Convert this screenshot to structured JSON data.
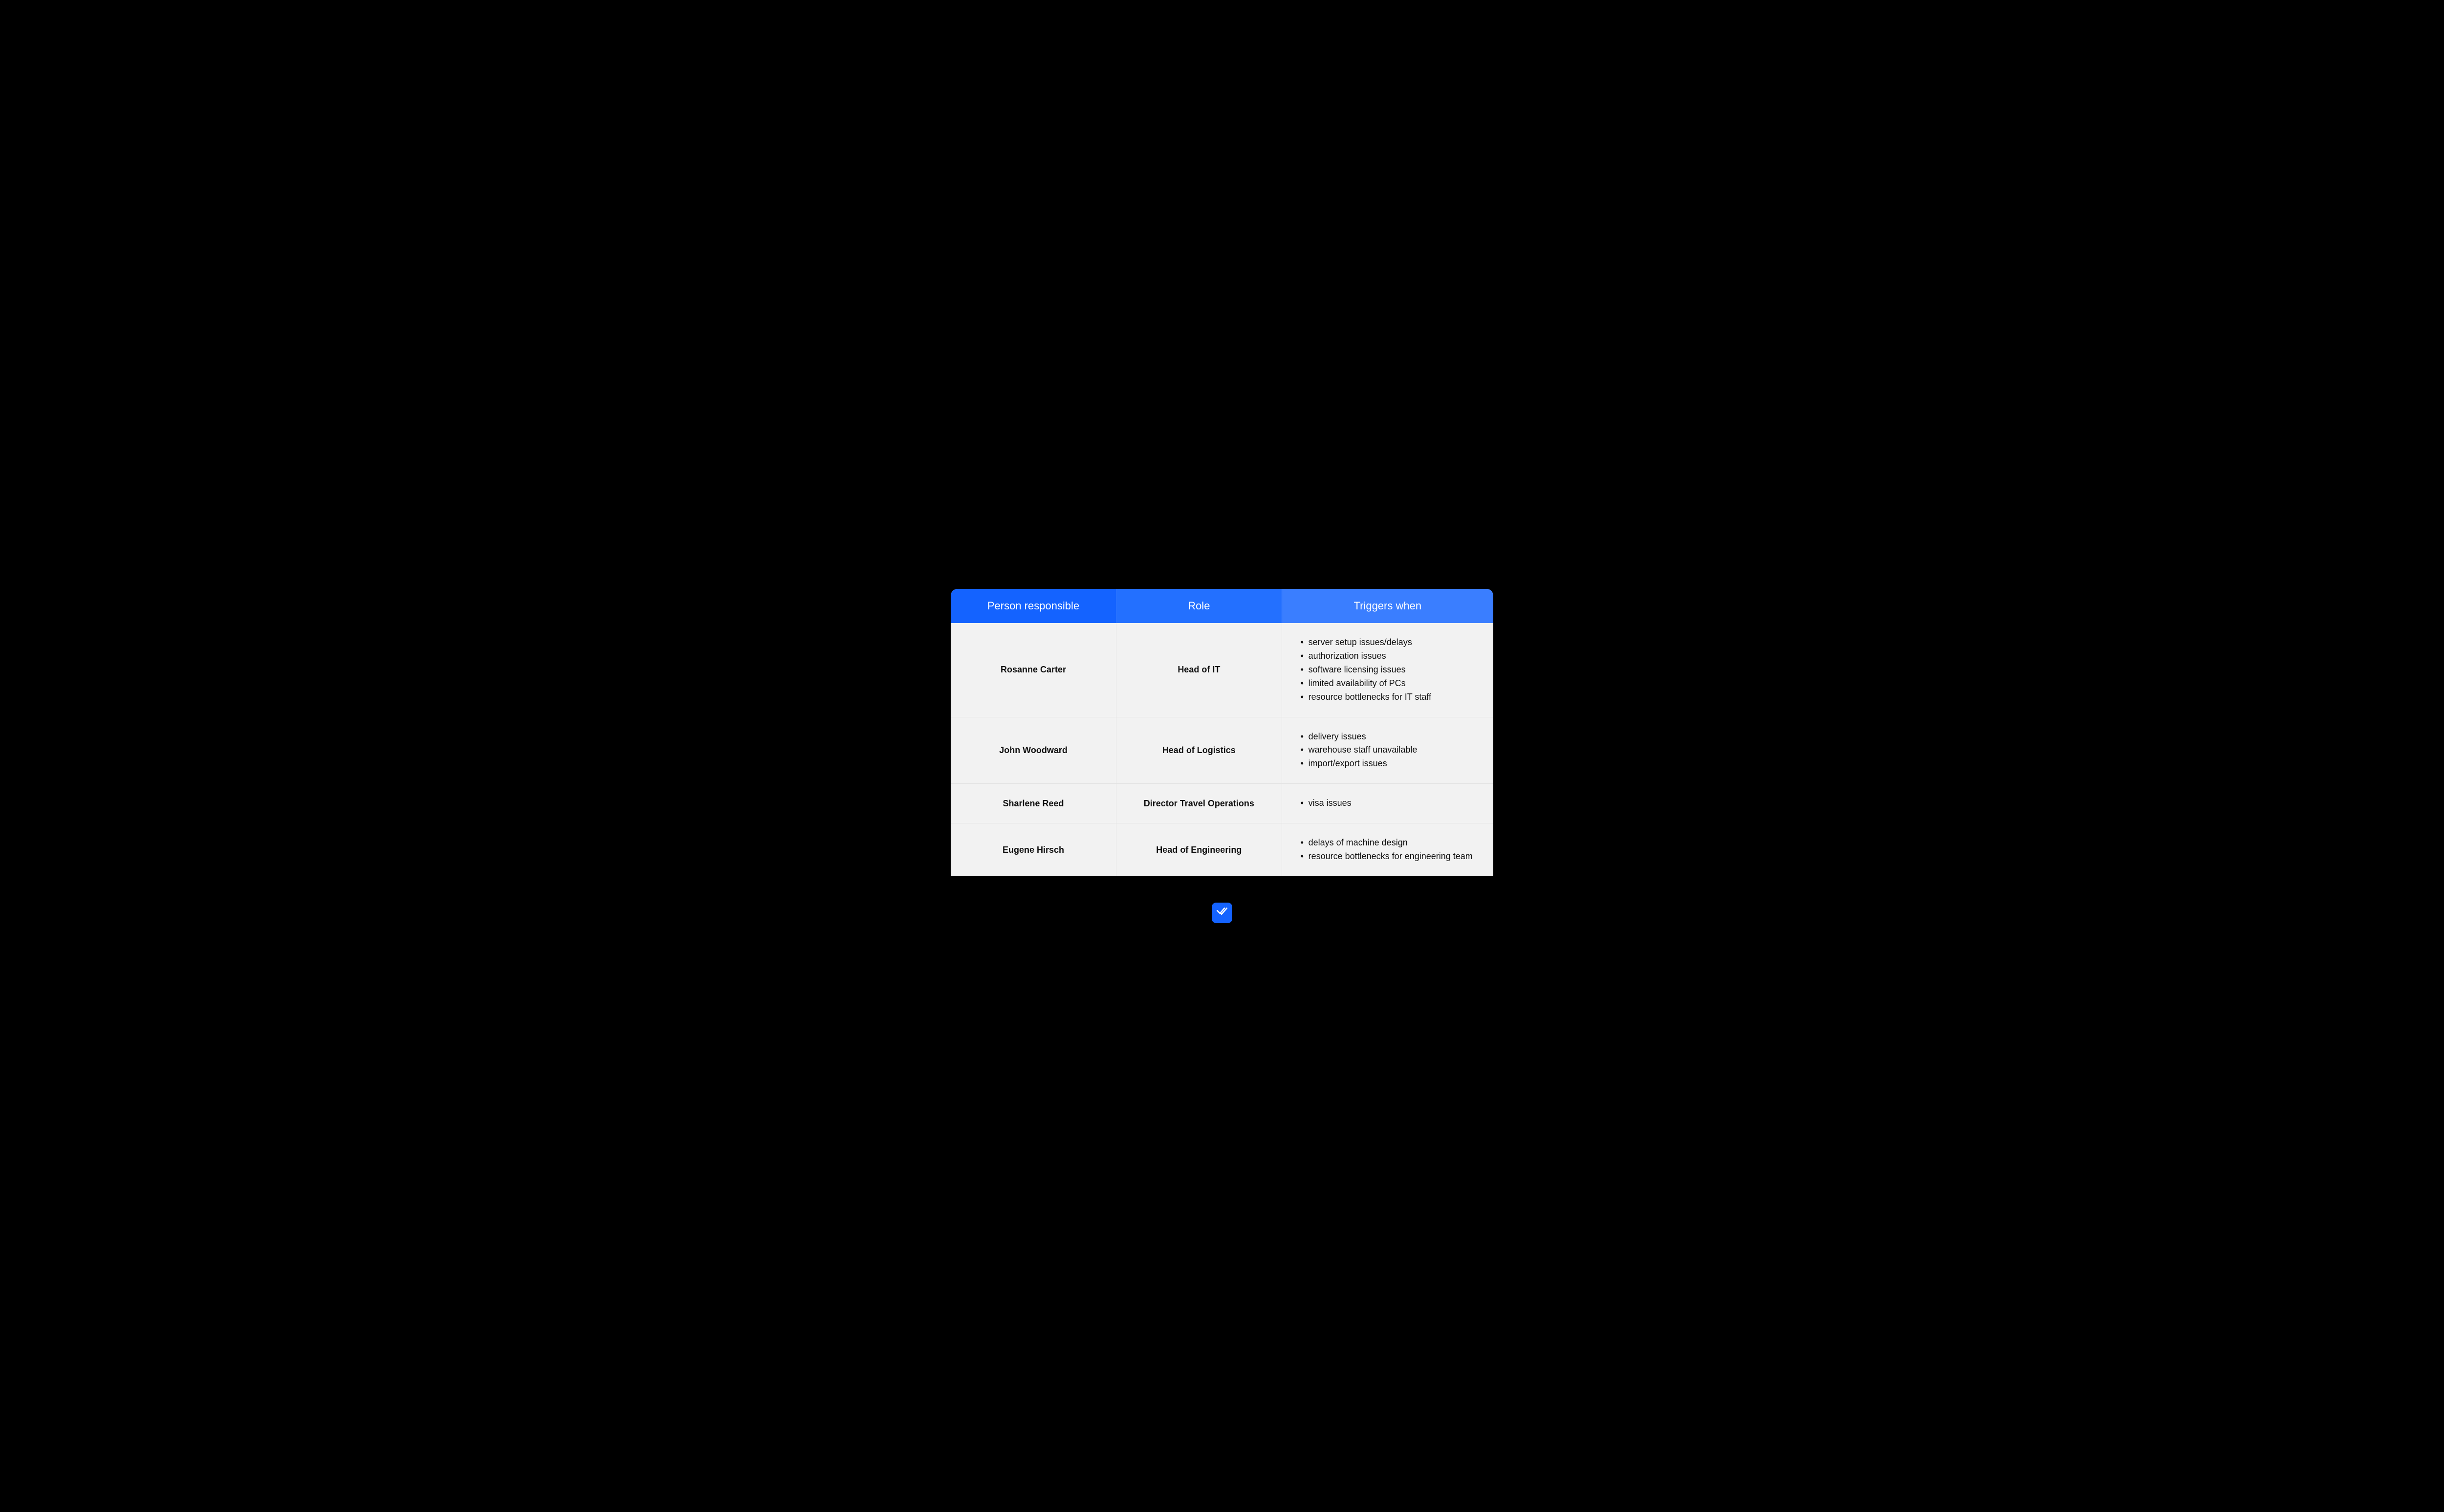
{
  "table": {
    "headers": [
      "Person responsible",
      "Role",
      "Triggers when"
    ],
    "rows": [
      {
        "person": "Rosanne Carter",
        "role": "Head of IT",
        "triggers": [
          "server setup issues/delays",
          "authorization issues",
          "software licensing issues",
          "limited availability of PCs",
          "resource bottlenecks for IT staff"
        ]
      },
      {
        "person": "John Woodward",
        "role": "Head of Logistics",
        "triggers": [
          "delivery issues",
          "warehouse staff unavailable",
          "import/export issues"
        ]
      },
      {
        "person": "Sharlene Reed",
        "role": "Director Travel Operations",
        "triggers": [
          "visa issues"
        ]
      },
      {
        "person": "Eugene Hirsch",
        "role": "Head of Engineering",
        "triggers": [
          "delays of machine design",
          "resource bottlenecks for engineering team"
        ]
      }
    ]
  }
}
